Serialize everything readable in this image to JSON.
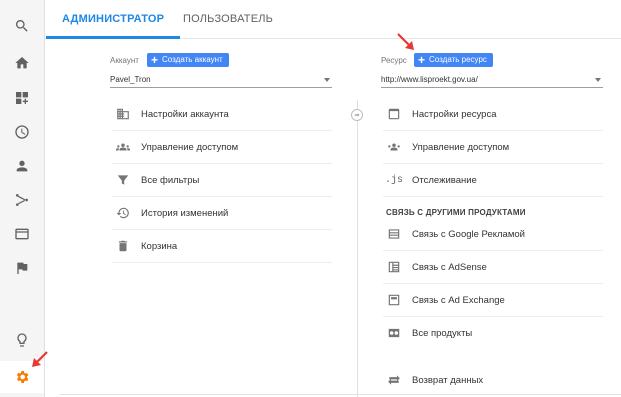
{
  "tabs": {
    "admin": "АДМИНИСТРАТОР",
    "user": "ПОЛЬЗОВАТЕЛЬ"
  },
  "account": {
    "label": "Аккаунт",
    "create_button": "Создать аккаунт",
    "selected": "Pavel_Tron",
    "items": [
      {
        "icon": "building-icon",
        "label": "Настройки аккаунта"
      },
      {
        "icon": "people-icon",
        "label": "Управление доступом"
      },
      {
        "icon": "filter-icon",
        "label": "Все фильтры"
      },
      {
        "icon": "history-icon",
        "label": "История изменений"
      },
      {
        "icon": "trash-icon",
        "label": "Корзина"
      }
    ]
  },
  "property": {
    "label": "Ресурс",
    "create_button": "Создать ресурс",
    "selected": "http://www.lisproekt.gov.ua/",
    "items": [
      {
        "icon": "window-icon",
        "label": "Настройки ресурса"
      },
      {
        "icon": "people-icon",
        "label": "Управление доступом"
      },
      {
        "icon": "js-icon",
        "icon_text": ".js",
        "label": "Отслеживание"
      }
    ],
    "section_title": "СВЯЗЬ С ДРУГИМИ ПРОДУКТАМИ",
    "linked": [
      {
        "icon": "ads-icon",
        "label": "Связь с Google Рекламой"
      },
      {
        "icon": "adsense-icon",
        "label": "Связь с AdSense"
      },
      {
        "icon": "adexchange-icon",
        "label": "Связь с Ad Exchange"
      },
      {
        "icon": "link-products-icon",
        "label": "Все продукты"
      }
    ],
    "extra": {
      "icon": "data-return-icon",
      "label": "Возврат данных"
    }
  },
  "colors": {
    "accent": "#1e88e5",
    "button": "#4285f4",
    "active_icon": "#f57c00",
    "annotation_arrow": "#e53935"
  }
}
